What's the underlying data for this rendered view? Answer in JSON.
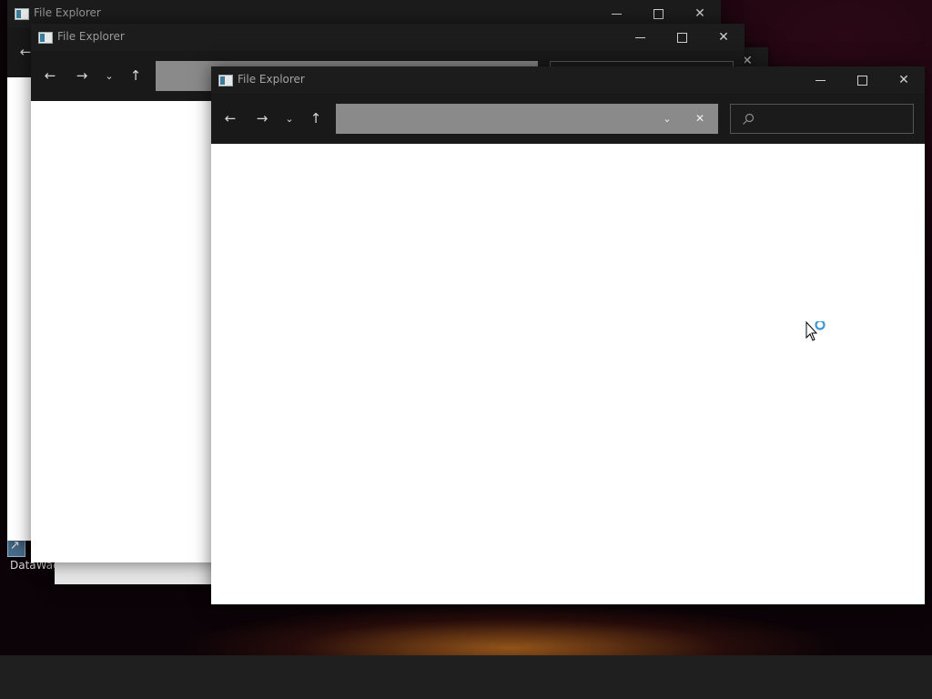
{
  "desktop": {
    "shortcut_label": "DataWag"
  },
  "windows": [
    {
      "title": "File Explorer"
    },
    {
      "title": "File Explorer"
    },
    {
      "title": "File Explorer"
    }
  ],
  "active_window": {
    "title": "File Explorer",
    "address_value": "",
    "search_value": ""
  },
  "icons": {
    "back": "arrow-left-icon",
    "forward": "arrow-right-icon",
    "recent": "chevron-down-icon",
    "up": "arrow-up-icon",
    "search": "search-icon",
    "busy_cursor": "busy-cursor-icon"
  },
  "colors": {
    "titlebar": "#1c1c1c",
    "address_bar": "#8a8a8a",
    "content": "#ffffff",
    "busy_ring": "#3a9ad9"
  }
}
